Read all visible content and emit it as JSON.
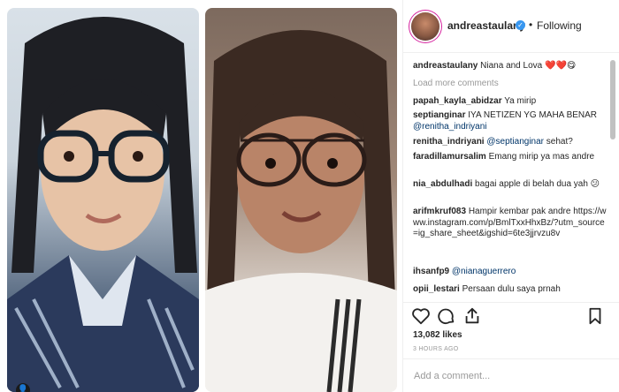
{
  "post": {
    "username": "andreastaulany",
    "separator": "•",
    "follow_status": "Following",
    "verified_glyph": "✓",
    "caption": {
      "username": "andreastaulany",
      "text": "Niana and Lova ❤️❤️😋"
    },
    "load_more": "Load more comments",
    "comments": [
      {
        "user": "papah_kayla_abidzar",
        "text": "Ya mirip",
        "mention": ""
      },
      {
        "user": "septianginar",
        "text": "IYA NETIZEN YG MAHA BENAR",
        "mention": "@renitha_indriyani"
      },
      {
        "user": "renitha_indriyani",
        "text": "sehat?",
        "mention": "@septianginar"
      },
      {
        "user": "faradillamursalim",
        "text": "Emang mirip ya mas andre",
        "mention": ""
      },
      {
        "user": "nia_abdulhadi",
        "text": "bagai apple di belah dua yah 😕",
        "mention": ""
      },
      {
        "user": "arifmkruf083",
        "text": "Hampir kembar pak andre https://www.instagram.com/p/BmlTxxHhxBz/?utm_source=ig_share_sheet&igshid=6te3jjrvzu8v",
        "mention": ""
      },
      {
        "user": "ihsanfp9",
        "text": "",
        "mention": "@nianaguerrero"
      },
      {
        "user": "opii_lestari",
        "text": "Persaan dulu saya prnah",
        "mention": ""
      }
    ],
    "likes": "13,082 likes",
    "time": "3 HOURS AGO",
    "add_comment_placeholder": "Add a comment...",
    "icons": [
      "heart-icon",
      "comment-icon",
      "share-icon",
      "bookmark-icon",
      "user-tag-icon"
    ],
    "user_tag_glyph": "👤",
    "colors": {
      "link": "#003569",
      "muted": "#999999",
      "verified": "#3897f0",
      "text": "#262626"
    }
  }
}
